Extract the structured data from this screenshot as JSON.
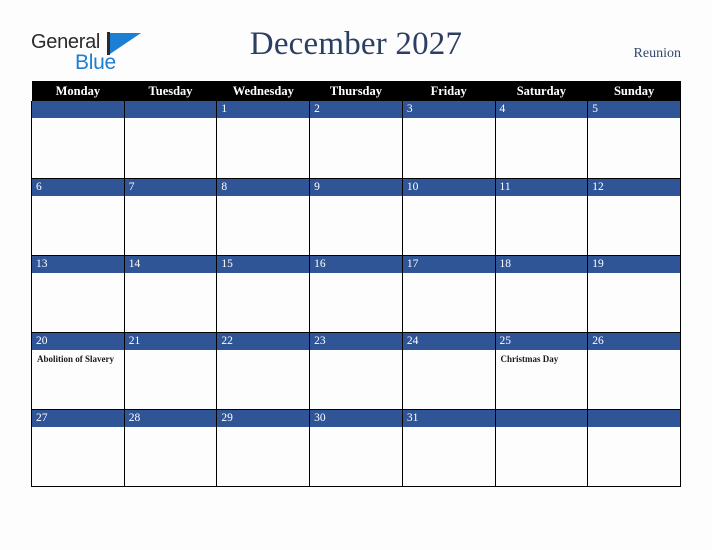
{
  "brand": {
    "name_part1": "General",
    "name_part2": "Blue",
    "triangle_icon": "triangle-icon",
    "accent_blue": "#1b7fd4",
    "text_dark": "#2b2b2b"
  },
  "header": {
    "title": "December 2027",
    "country": "Reunion",
    "title_color": "#2c3f63"
  },
  "calendar": {
    "header_bg": "#000000",
    "daynum_bg": "#2f5596",
    "cell_bg": "#fdfdfd",
    "weekday_headers": [
      "Monday",
      "Tuesday",
      "Wednesday",
      "Thursday",
      "Friday",
      "Saturday",
      "Sunday"
    ],
    "weeks": [
      [
        {
          "day": "",
          "event": ""
        },
        {
          "day": "",
          "event": ""
        },
        {
          "day": "1",
          "event": ""
        },
        {
          "day": "2",
          "event": ""
        },
        {
          "day": "3",
          "event": ""
        },
        {
          "day": "4",
          "event": ""
        },
        {
          "day": "5",
          "event": ""
        }
      ],
      [
        {
          "day": "6",
          "event": ""
        },
        {
          "day": "7",
          "event": ""
        },
        {
          "day": "8",
          "event": ""
        },
        {
          "day": "9",
          "event": ""
        },
        {
          "day": "10",
          "event": ""
        },
        {
          "day": "11",
          "event": ""
        },
        {
          "day": "12",
          "event": ""
        }
      ],
      [
        {
          "day": "13",
          "event": ""
        },
        {
          "day": "14",
          "event": ""
        },
        {
          "day": "15",
          "event": ""
        },
        {
          "day": "16",
          "event": ""
        },
        {
          "day": "17",
          "event": ""
        },
        {
          "day": "18",
          "event": ""
        },
        {
          "day": "19",
          "event": ""
        }
      ],
      [
        {
          "day": "20",
          "event": "Abolition of Slavery"
        },
        {
          "day": "21",
          "event": ""
        },
        {
          "day": "22",
          "event": ""
        },
        {
          "day": "23",
          "event": ""
        },
        {
          "day": "24",
          "event": ""
        },
        {
          "day": "25",
          "event": "Christmas Day"
        },
        {
          "day": "26",
          "event": ""
        }
      ],
      [
        {
          "day": "27",
          "event": ""
        },
        {
          "day": "28",
          "event": ""
        },
        {
          "day": "29",
          "event": ""
        },
        {
          "day": "30",
          "event": ""
        },
        {
          "day": "31",
          "event": ""
        },
        {
          "day": "",
          "event": ""
        },
        {
          "day": "",
          "event": ""
        }
      ]
    ]
  }
}
